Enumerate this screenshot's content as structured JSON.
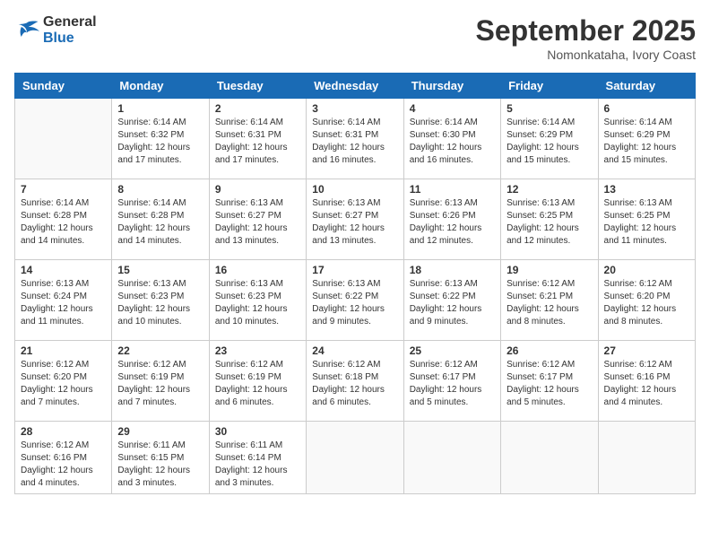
{
  "logo": {
    "text_general": "General",
    "text_blue": "Blue"
  },
  "title": "September 2025",
  "location": "Nomonkataha, Ivory Coast",
  "days_of_week": [
    "Sunday",
    "Monday",
    "Tuesday",
    "Wednesday",
    "Thursday",
    "Friday",
    "Saturday"
  ],
  "weeks": [
    [
      {
        "day": "",
        "info": ""
      },
      {
        "day": "1",
        "info": "Sunrise: 6:14 AM\nSunset: 6:32 PM\nDaylight: 12 hours\nand 17 minutes."
      },
      {
        "day": "2",
        "info": "Sunrise: 6:14 AM\nSunset: 6:31 PM\nDaylight: 12 hours\nand 17 minutes."
      },
      {
        "day": "3",
        "info": "Sunrise: 6:14 AM\nSunset: 6:31 PM\nDaylight: 12 hours\nand 16 minutes."
      },
      {
        "day": "4",
        "info": "Sunrise: 6:14 AM\nSunset: 6:30 PM\nDaylight: 12 hours\nand 16 minutes."
      },
      {
        "day": "5",
        "info": "Sunrise: 6:14 AM\nSunset: 6:29 PM\nDaylight: 12 hours\nand 15 minutes."
      },
      {
        "day": "6",
        "info": "Sunrise: 6:14 AM\nSunset: 6:29 PM\nDaylight: 12 hours\nand 15 minutes."
      }
    ],
    [
      {
        "day": "7",
        "info": "Sunrise: 6:14 AM\nSunset: 6:28 PM\nDaylight: 12 hours\nand 14 minutes."
      },
      {
        "day": "8",
        "info": "Sunrise: 6:14 AM\nSunset: 6:28 PM\nDaylight: 12 hours\nand 14 minutes."
      },
      {
        "day": "9",
        "info": "Sunrise: 6:13 AM\nSunset: 6:27 PM\nDaylight: 12 hours\nand 13 minutes."
      },
      {
        "day": "10",
        "info": "Sunrise: 6:13 AM\nSunset: 6:27 PM\nDaylight: 12 hours\nand 13 minutes."
      },
      {
        "day": "11",
        "info": "Sunrise: 6:13 AM\nSunset: 6:26 PM\nDaylight: 12 hours\nand 12 minutes."
      },
      {
        "day": "12",
        "info": "Sunrise: 6:13 AM\nSunset: 6:25 PM\nDaylight: 12 hours\nand 12 minutes."
      },
      {
        "day": "13",
        "info": "Sunrise: 6:13 AM\nSunset: 6:25 PM\nDaylight: 12 hours\nand 11 minutes."
      }
    ],
    [
      {
        "day": "14",
        "info": "Sunrise: 6:13 AM\nSunset: 6:24 PM\nDaylight: 12 hours\nand 11 minutes."
      },
      {
        "day": "15",
        "info": "Sunrise: 6:13 AM\nSunset: 6:23 PM\nDaylight: 12 hours\nand 10 minutes."
      },
      {
        "day": "16",
        "info": "Sunrise: 6:13 AM\nSunset: 6:23 PM\nDaylight: 12 hours\nand 10 minutes."
      },
      {
        "day": "17",
        "info": "Sunrise: 6:13 AM\nSunset: 6:22 PM\nDaylight: 12 hours\nand 9 minutes."
      },
      {
        "day": "18",
        "info": "Sunrise: 6:13 AM\nSunset: 6:22 PM\nDaylight: 12 hours\nand 9 minutes."
      },
      {
        "day": "19",
        "info": "Sunrise: 6:12 AM\nSunset: 6:21 PM\nDaylight: 12 hours\nand 8 minutes."
      },
      {
        "day": "20",
        "info": "Sunrise: 6:12 AM\nSunset: 6:20 PM\nDaylight: 12 hours\nand 8 minutes."
      }
    ],
    [
      {
        "day": "21",
        "info": "Sunrise: 6:12 AM\nSunset: 6:20 PM\nDaylight: 12 hours\nand 7 minutes."
      },
      {
        "day": "22",
        "info": "Sunrise: 6:12 AM\nSunset: 6:19 PM\nDaylight: 12 hours\nand 7 minutes."
      },
      {
        "day": "23",
        "info": "Sunrise: 6:12 AM\nSunset: 6:19 PM\nDaylight: 12 hours\nand 6 minutes."
      },
      {
        "day": "24",
        "info": "Sunrise: 6:12 AM\nSunset: 6:18 PM\nDaylight: 12 hours\nand 6 minutes."
      },
      {
        "day": "25",
        "info": "Sunrise: 6:12 AM\nSunset: 6:17 PM\nDaylight: 12 hours\nand 5 minutes."
      },
      {
        "day": "26",
        "info": "Sunrise: 6:12 AM\nSunset: 6:17 PM\nDaylight: 12 hours\nand 5 minutes."
      },
      {
        "day": "27",
        "info": "Sunrise: 6:12 AM\nSunset: 6:16 PM\nDaylight: 12 hours\nand 4 minutes."
      }
    ],
    [
      {
        "day": "28",
        "info": "Sunrise: 6:12 AM\nSunset: 6:16 PM\nDaylight: 12 hours\nand 4 minutes."
      },
      {
        "day": "29",
        "info": "Sunrise: 6:11 AM\nSunset: 6:15 PM\nDaylight: 12 hours\nand 3 minutes."
      },
      {
        "day": "30",
        "info": "Sunrise: 6:11 AM\nSunset: 6:14 PM\nDaylight: 12 hours\nand 3 minutes."
      },
      {
        "day": "",
        "info": ""
      },
      {
        "day": "",
        "info": ""
      },
      {
        "day": "",
        "info": ""
      },
      {
        "day": "",
        "info": ""
      }
    ]
  ]
}
